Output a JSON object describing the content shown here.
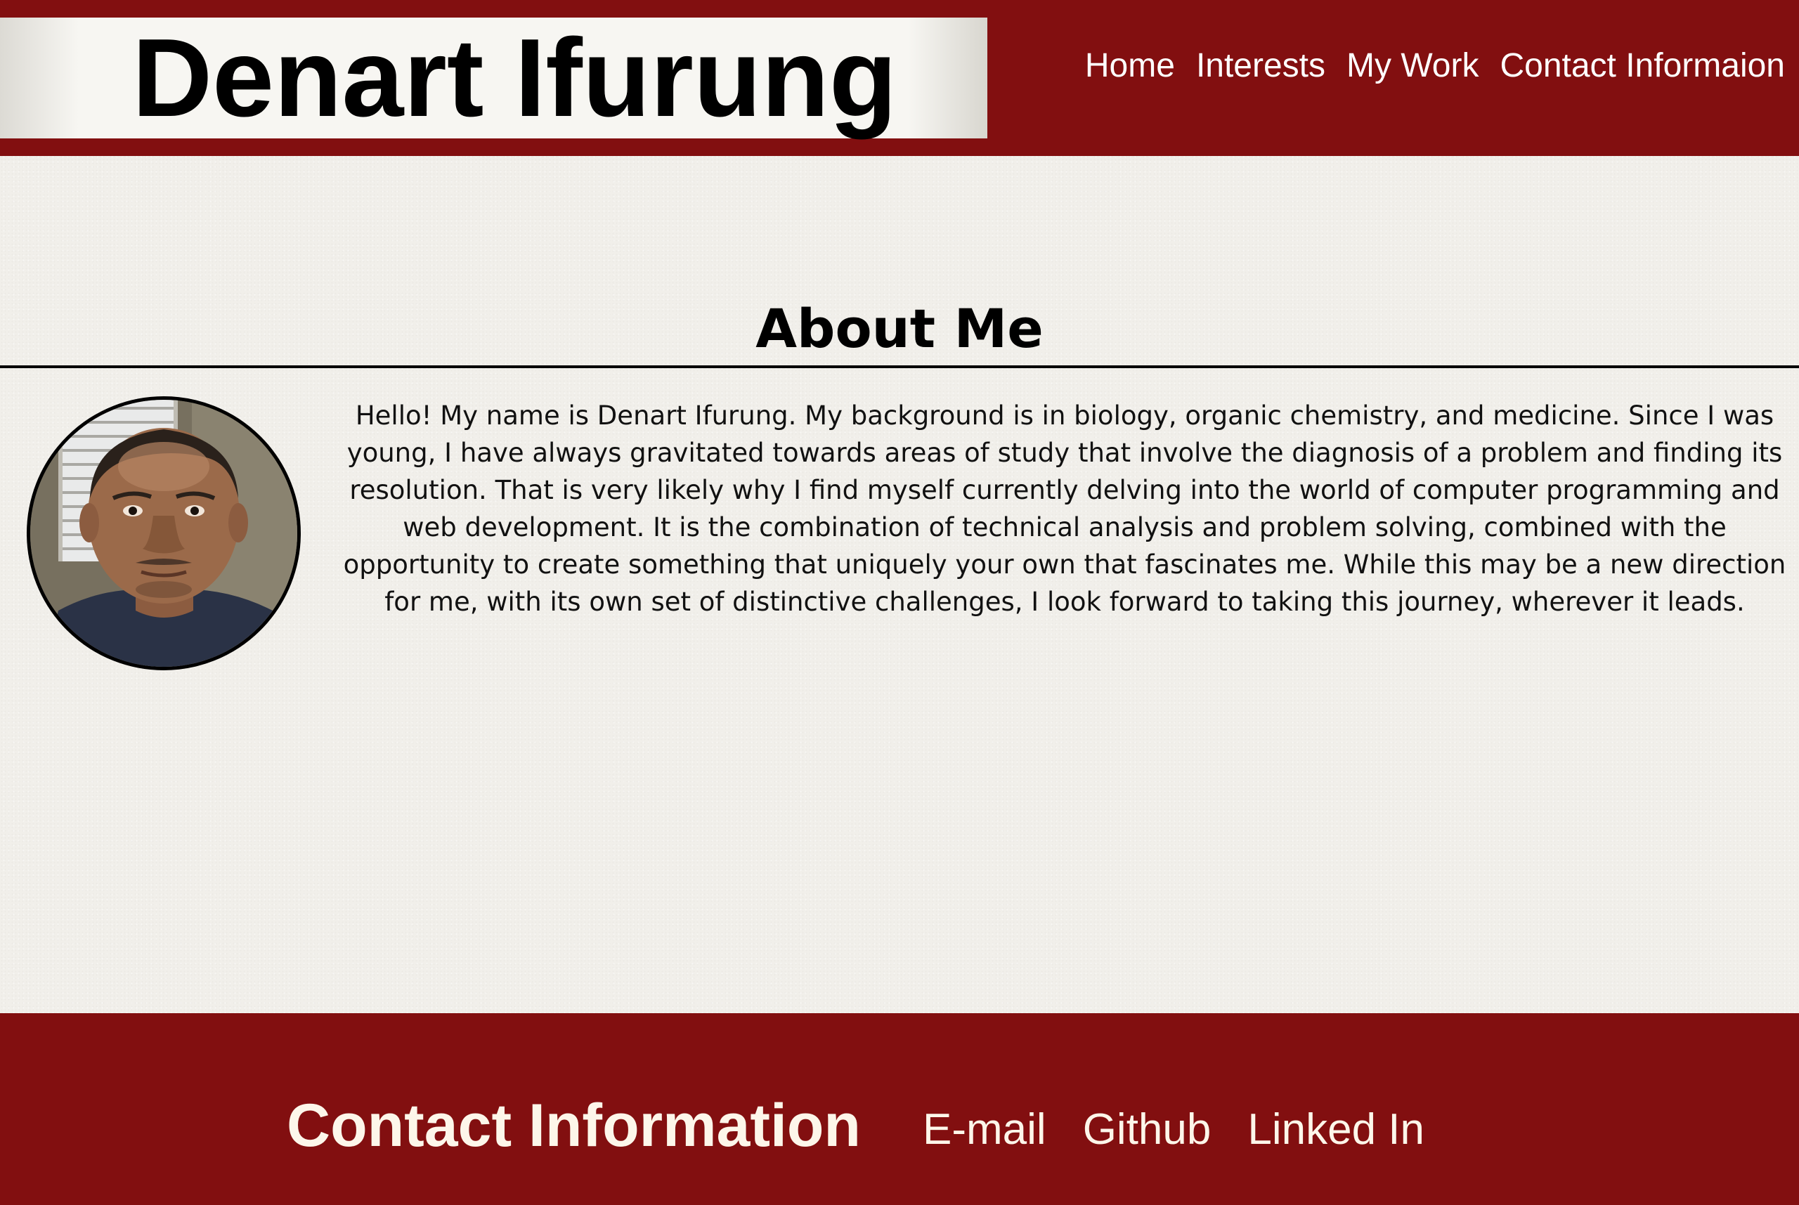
{
  "header": {
    "site_name": "Denart Ifurung",
    "nav": [
      {
        "label": "Home"
      },
      {
        "label": "Interests"
      },
      {
        "label": "My Work"
      },
      {
        "label": "Contact Informaion"
      }
    ]
  },
  "about": {
    "title": "About Me",
    "bio": "Hello! My name is Denart Ifurung. My background is in biology, organic chemistry, and medicine. Since I was young, I have always gravitated towards areas of study that involve the diagnosis of a problem and finding its resolution. That is very likely why I find myself currently delving into the world of computer programming and web development. It is the combination of technical analysis and problem solving, combined with the opportunity to create something that uniquely your own that fascinates me. While this may be a new direction for me, with its own set of distinctive challenges, I look forward to taking this journey, wherever it leads."
  },
  "footer": {
    "title": "Contact Information",
    "links": [
      {
        "label": "E-mail"
      },
      {
        "label": "Github"
      },
      {
        "label": "Linked In"
      }
    ]
  },
  "colors": {
    "brand_red": "#820f10",
    "paper": "#f1efea",
    "text": "#000000",
    "nav_text": "#ffffff",
    "footer_text": "#fdf6ea"
  }
}
